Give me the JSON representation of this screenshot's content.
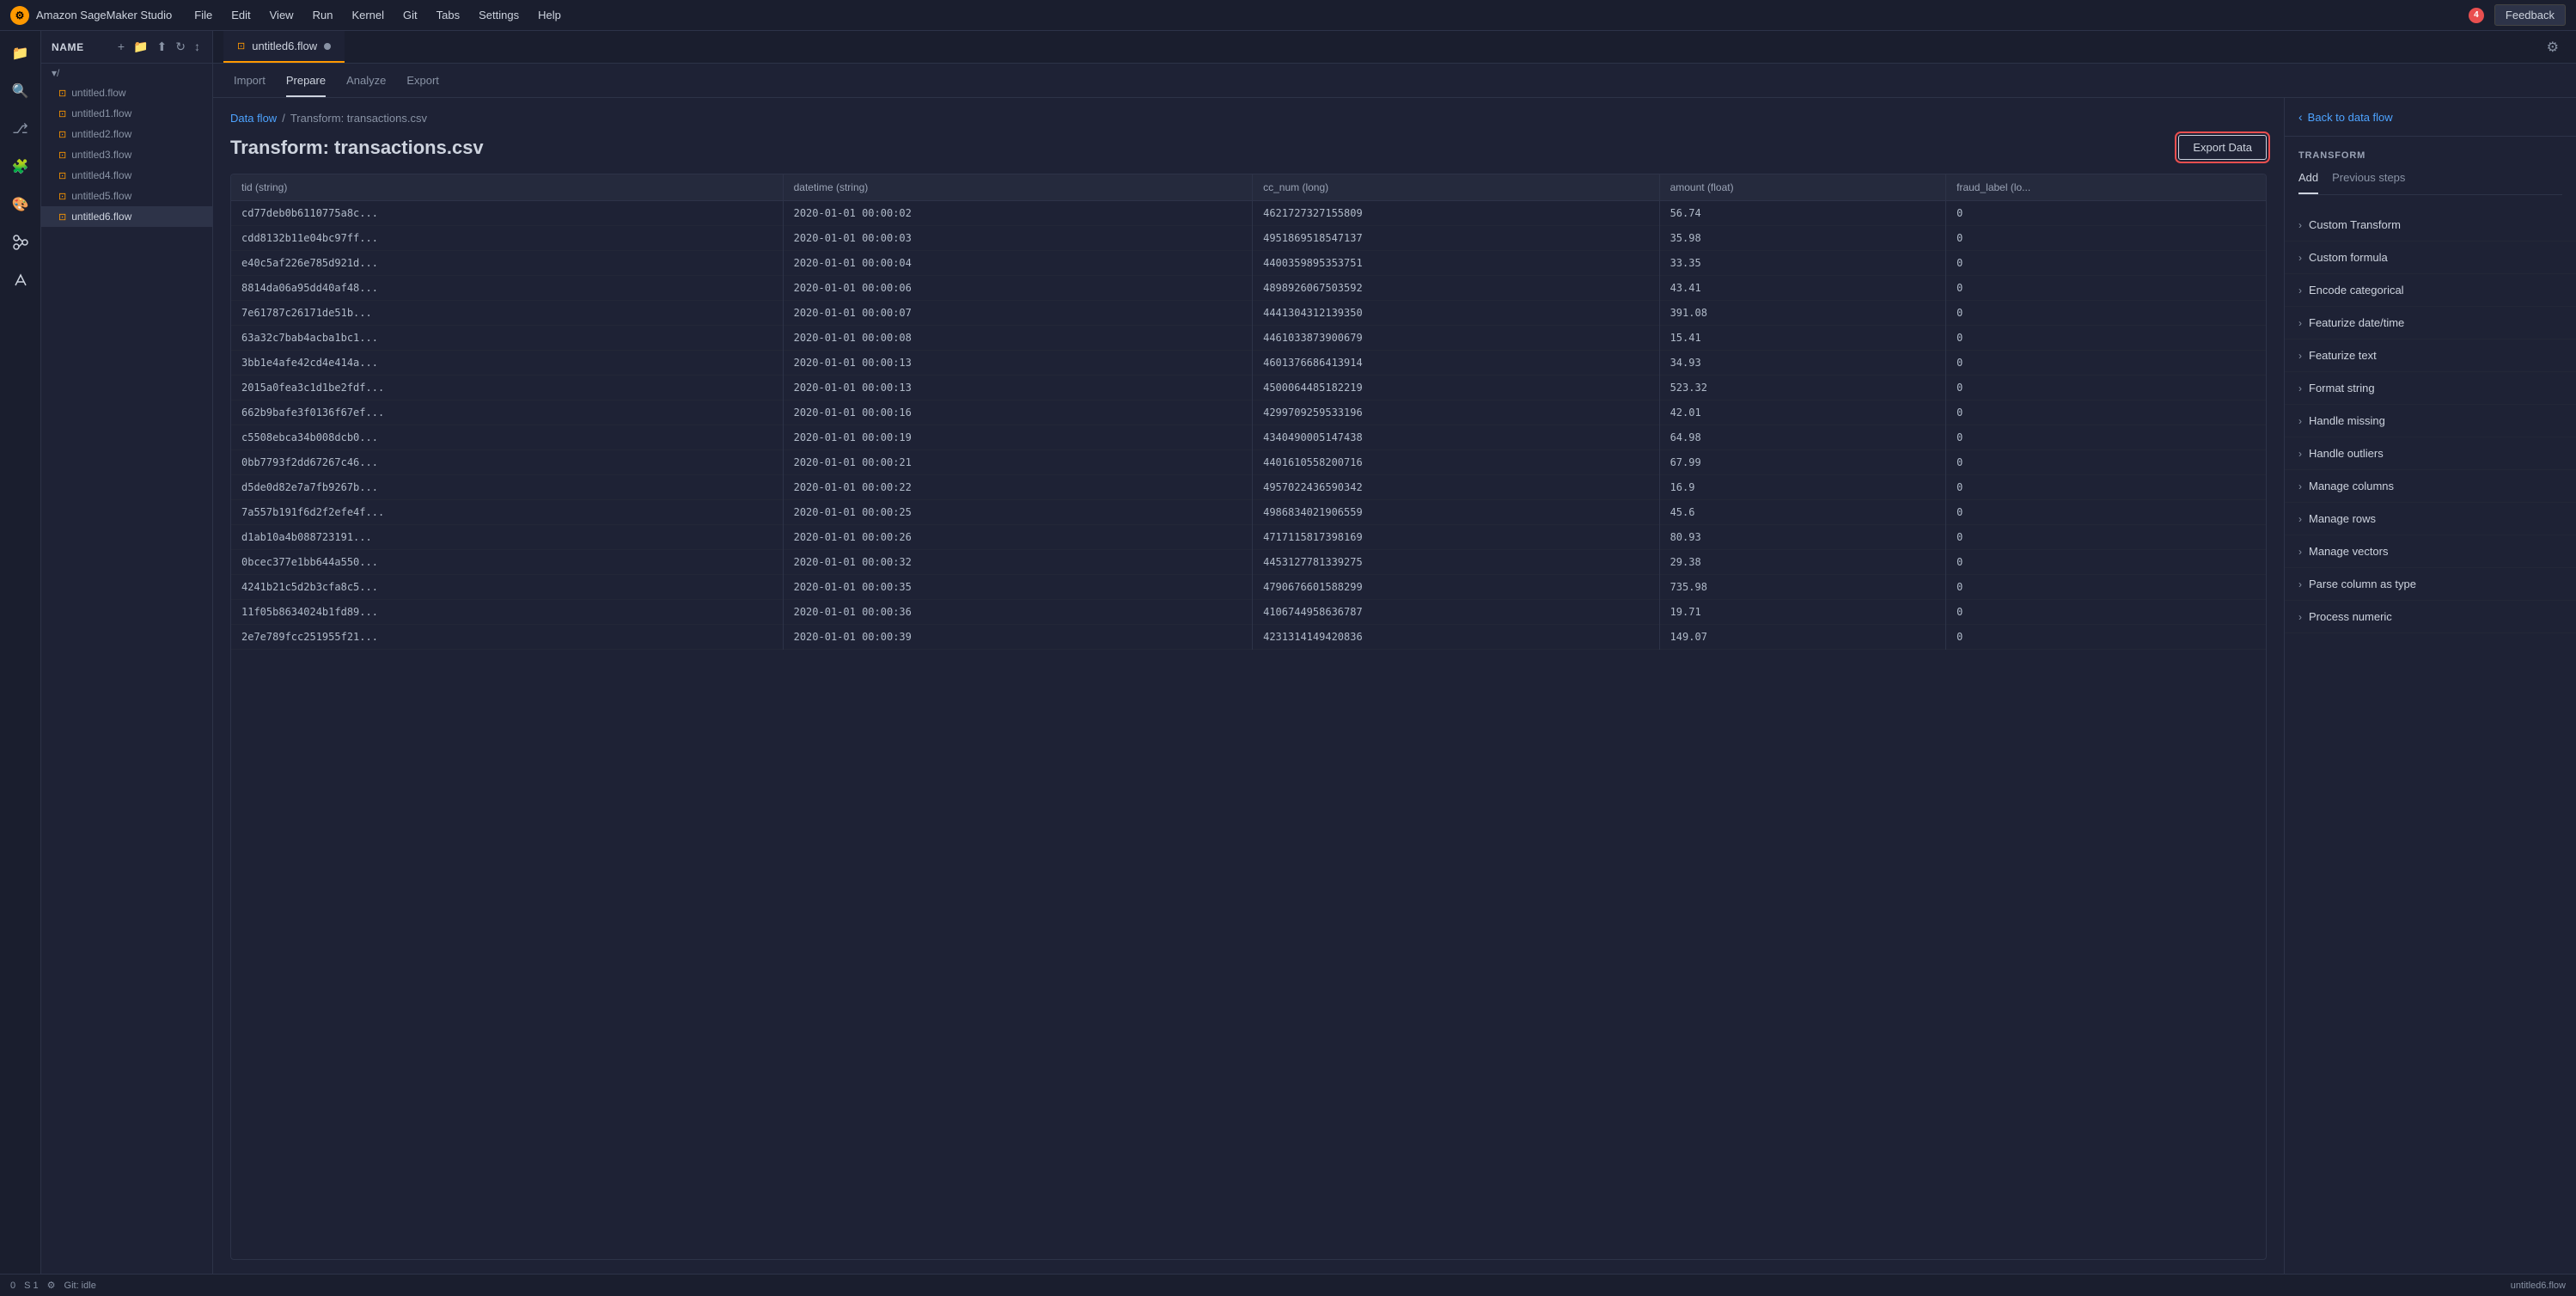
{
  "app": {
    "name": "Amazon SageMaker Studio",
    "notification_count": "4"
  },
  "menu": {
    "items": [
      "File",
      "Edit",
      "View",
      "Run",
      "Kernel",
      "Git",
      "Tabs",
      "Settings",
      "Help"
    ],
    "feedback_label": "Feedback"
  },
  "tabs": {
    "active_tab": "untitled6.flow",
    "items": [
      {
        "label": "untitled6.flow",
        "active": true
      }
    ]
  },
  "inner_tabs": {
    "items": [
      "Import",
      "Prepare",
      "Analyze",
      "Export"
    ],
    "active": "Prepare"
  },
  "breadcrumb": {
    "link": "Data flow",
    "separator": "/",
    "current": "Transform: transactions.csv"
  },
  "page": {
    "title": "Transform: transactions.csv",
    "export_button": "Export Data"
  },
  "table": {
    "columns": [
      "tid (string)",
      "datetime (string)",
      "cc_num (long)",
      "amount (float)",
      "fraud_label (lo..."
    ],
    "rows": [
      [
        "cd77deb0b6110775a8c...",
        "2020-01-01 00:00:02",
        "4621727327155809",
        "56.74",
        "0"
      ],
      [
        "cdd8132b11e04bc97ff...",
        "2020-01-01 00:00:03",
        "4951869518547137",
        "35.98",
        "0"
      ],
      [
        "e40c5af226e785d921d...",
        "2020-01-01 00:00:04",
        "4400359895353751",
        "33.35",
        "0"
      ],
      [
        "8814da06a95dd40af48...",
        "2020-01-01 00:00:06",
        "4898926067503592",
        "43.41",
        "0"
      ],
      [
        "7e61787c26171de51b...",
        "2020-01-01 00:00:07",
        "4441304312139350",
        "391.08",
        "0"
      ],
      [
        "63a32c7bab4acba1bc1...",
        "2020-01-01 00:00:08",
        "4461033873900679",
        "15.41",
        "0"
      ],
      [
        "3bb1e4afe42cd4e414a...",
        "2020-01-01 00:00:13",
        "4601376686413914",
        "34.93",
        "0"
      ],
      [
        "2015a0fea3c1d1be2fdf...",
        "2020-01-01 00:00:13",
        "4500064485182219",
        "523.32",
        "0"
      ],
      [
        "662b9bafe3f0136f67ef...",
        "2020-01-01 00:00:16",
        "4299709259533196",
        "42.01",
        "0"
      ],
      [
        "c5508ebca34b008dcb0...",
        "2020-01-01 00:00:19",
        "4340490005147438",
        "64.98",
        "0"
      ],
      [
        "0bb7793f2dd67267c46...",
        "2020-01-01 00:00:21",
        "4401610558200716",
        "67.99",
        "0"
      ],
      [
        "d5de0d82e7a7fb9267b...",
        "2020-01-01 00:00:22",
        "4957022436590342",
        "16.9",
        "0"
      ],
      [
        "7a557b191f6d2f2efe4f...",
        "2020-01-01 00:00:25",
        "4986834021906559",
        "45.6",
        "0"
      ],
      [
        "d1ab10a4b088723191...",
        "2020-01-01 00:00:26",
        "4717115817398169",
        "80.93",
        "0"
      ],
      [
        "0bcec377e1bb644a550...",
        "2020-01-01 00:00:32",
        "4453127781339275",
        "29.38",
        "0"
      ],
      [
        "4241b21c5d2b3cfa8c5...",
        "2020-01-01 00:00:35",
        "4790676601588299",
        "735.98",
        "0"
      ],
      [
        "11f05b8634024b1fd89...",
        "2020-01-01 00:00:36",
        "4106744958636787",
        "19.71",
        "0"
      ],
      [
        "2e7e789fcc251955f21...",
        "2020-01-01 00:00:39",
        "4231314149420836",
        "149.07",
        "0"
      ]
    ]
  },
  "right_panel": {
    "back_label": "Back to data flow",
    "transform_title": "TRANSFORM",
    "tabs": [
      "Add",
      "Previous steps"
    ],
    "active_tab": "Add",
    "items": [
      "Custom Transform",
      "Custom formula",
      "Encode categorical",
      "Featurize date/time",
      "Featurize text",
      "Format string",
      "Handle missing",
      "Handle outliers",
      "Manage columns",
      "Manage rows",
      "Manage vectors",
      "Parse column as type",
      "Process numeric"
    ]
  },
  "file_panel": {
    "title": "Name",
    "folder": "/",
    "files": [
      "untitled.flow",
      "untitled1.flow",
      "untitled2.flow",
      "untitled3.flow",
      "untitled4.flow",
      "untitled5.flow",
      "untitled6.flow"
    ]
  },
  "status_bar": {
    "left": [
      "0",
      "S 1"
    ],
    "git_status": "Git: idle",
    "right": "untitled6.flow"
  }
}
